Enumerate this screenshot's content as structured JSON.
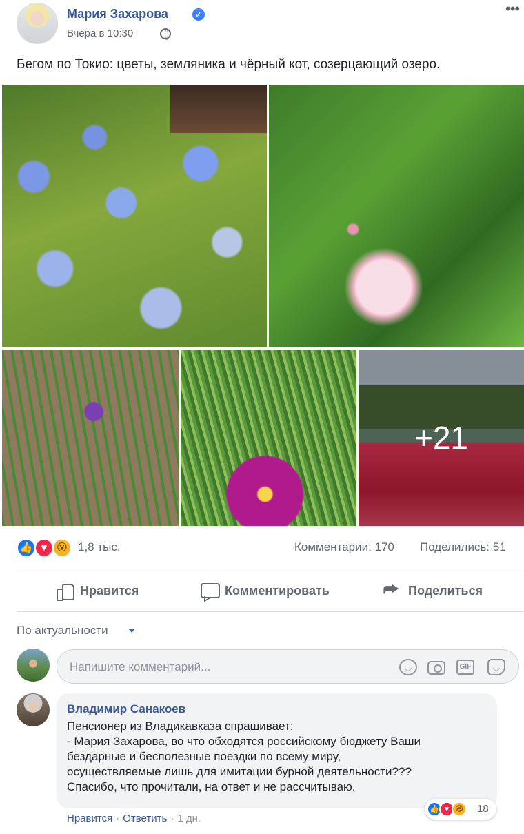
{
  "post": {
    "author": "Мария Захарова",
    "timestamp": "Вчера в 10:30",
    "caption": "Бегом по Токио: цветы, земляника и чёрный кот, созерцающий озеро.",
    "more_photos": "+21",
    "reactions_count": "1,8 тыс.",
    "comments": "Комментарии: 170",
    "shares": "Поделились: 51",
    "icons": {
      "verified": "verified-badge-icon",
      "privacy": "globe-icon",
      "more": "more-options-icon"
    }
  },
  "actions": {
    "like": "Нравится",
    "comment": "Комментировать",
    "share": "Поделиться"
  },
  "comments_section": {
    "sort_label": "По актуальности",
    "input_placeholder": "Напишите комментарий...",
    "gif_label": "GIF"
  },
  "comment": {
    "author": "Владимир Санакоев",
    "lines": [
      "Пенсионер из Владикавказа спрашивает:",
      "- Мария Захарова, во что обходятся российскому бюджету Ваши",
      "бездарные и бесполезные поездки по всему миру,",
      "осуществляемые лишь для имитации бурной деятельности???",
      "Спасибо, что прочитали, на ответ и не рассчитываю."
    ],
    "reaction_count": "18",
    "like_label": "Нравится",
    "reply_label": "Ответить",
    "age": "1 дн."
  },
  "colors": {
    "link": "#385898",
    "like": "#1877f2",
    "love": "#f0284a",
    "wow": "#f7b125"
  }
}
